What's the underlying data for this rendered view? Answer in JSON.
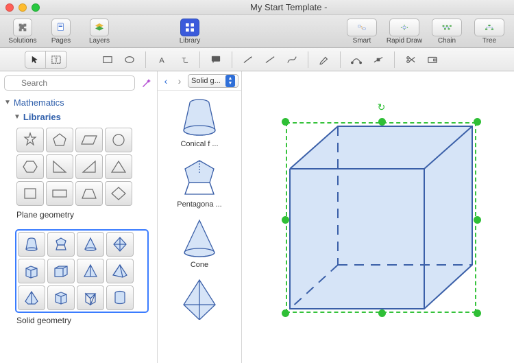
{
  "window": {
    "title": "My Start Template -"
  },
  "toolbar": {
    "solutions": "Solutions",
    "pages": "Pages",
    "layers": "Layers",
    "library": "Library",
    "smart": "Smart",
    "rapid_draw": "Rapid Draw",
    "chain": "Chain",
    "tree": "Tree"
  },
  "search": {
    "placeholder": "Search"
  },
  "tree": {
    "mathematics": "Mathematics",
    "libraries": "Libraries",
    "plane_geometry": "Plane geometry",
    "solid_geometry": "Solid geometry"
  },
  "library_dropdown": {
    "label": "Solid g..."
  },
  "shapes": {
    "conical_frustum": "Conical f ...",
    "pentagonal": "Pentagona ...",
    "cone": "Cone"
  },
  "icons": {
    "solutions": "puzzle-icon",
    "pages": "page-icon",
    "layers": "layers-icon",
    "library": "grid-icon",
    "smart": "smart-icon",
    "rapid": "rapid-icon",
    "chain": "chain-icon",
    "tree": "tree-icon"
  },
  "colors": {
    "accent": "#3a7cff",
    "shape_stroke": "#3a5fa8",
    "shape_fill": "#d6e4f7",
    "handle": "#2fbf36"
  }
}
